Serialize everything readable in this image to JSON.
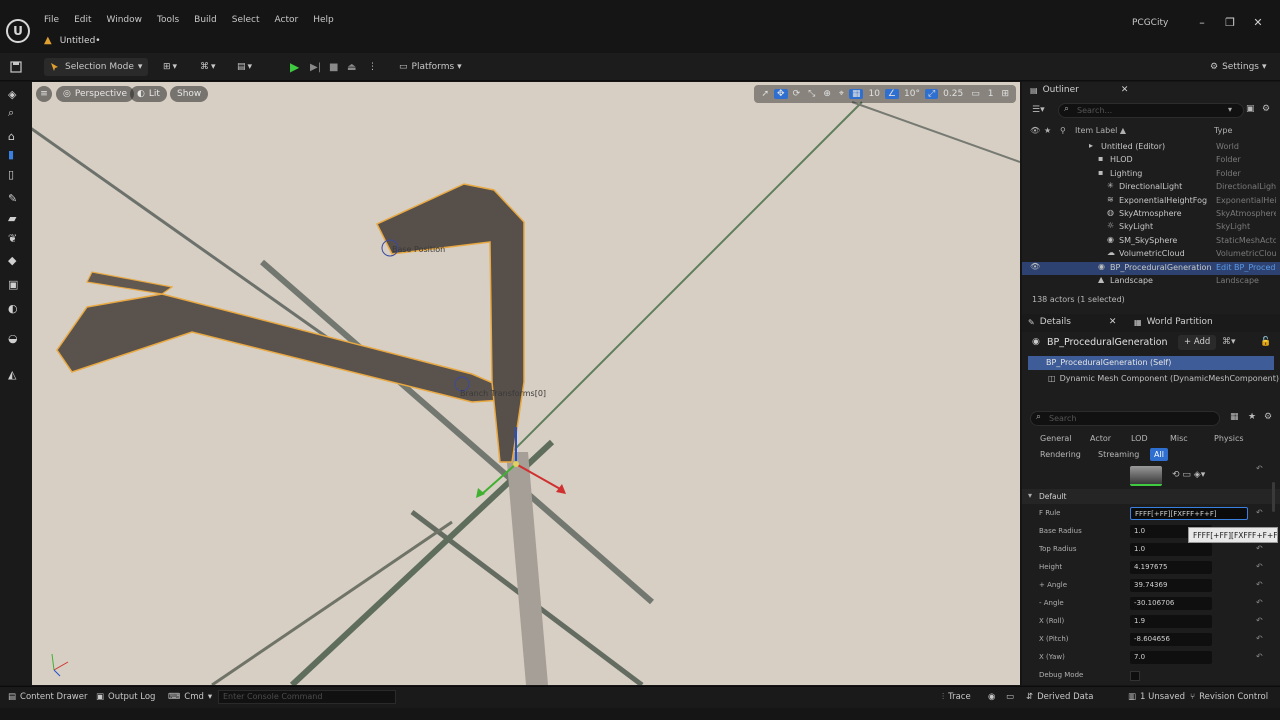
{
  "window": {
    "menu": [
      "File",
      "Edit",
      "Window",
      "Tools",
      "Build",
      "Select",
      "Actor",
      "Help"
    ],
    "document_tab": "Untitled•",
    "project_name": "PCGCity",
    "controls": [
      "–",
      "❐",
      "✕"
    ]
  },
  "toolbar": {
    "selection_mode": "Selection Mode",
    "platforms": "Platforms",
    "settings": "Settings"
  },
  "viewport": {
    "perspective": "Perspective",
    "lit": "Lit",
    "show": "Show",
    "grid_snap": "10",
    "rot_snap": "10°",
    "scale_snap": "0.25",
    "camera_speed": "1",
    "label_base_position": "Base Position",
    "label_branch": "Branch Transforms[0]"
  },
  "outliner": {
    "tab_label": "Outliner",
    "search_placeholder": "Search...",
    "col_item_label": "Item Label ▲",
    "col_type": "Type",
    "rows": [
      {
        "name": "Untitled (Editor)",
        "type": "World",
        "indent": 1,
        "icon": "▸"
      },
      {
        "name": "HLOD",
        "type": "Folder",
        "indent": 2,
        "icon": "▪"
      },
      {
        "name": "Lighting",
        "type": "Folder",
        "indent": 2,
        "icon": "▪"
      },
      {
        "name": "DirectionalLight",
        "type": "DirectionalLight",
        "indent": 3,
        "icon": "✳"
      },
      {
        "name": "ExponentialHeightFog",
        "type": "ExponentialHeightFog",
        "indent": 3,
        "icon": "≋"
      },
      {
        "name": "SkyAtmosphere",
        "type": "SkyAtmosphere",
        "indent": 3,
        "icon": "◍"
      },
      {
        "name": "SkyLight",
        "type": "SkyLight",
        "indent": 3,
        "icon": "☼"
      },
      {
        "name": "SM_SkySphere",
        "type": "StaticMeshActor",
        "indent": 3,
        "icon": "◉"
      },
      {
        "name": "VolumetricCloud",
        "type": "VolumetricCloud",
        "indent": 3,
        "icon": "☁"
      },
      {
        "name": "BP_ProceduralGeneration",
        "type": "Edit BP_ProceduralGeneration",
        "indent": 2,
        "icon": "◉",
        "selected": true
      },
      {
        "name": "Landscape",
        "type": "Landscape",
        "indent": 2,
        "icon": "▲"
      }
    ],
    "actor_count": "138 actors (1 selected)"
  },
  "details": {
    "tab_label": "Details",
    "world_partition_tab": "World Partition",
    "actor_name": "BP_ProceduralGeneration",
    "add_button": "+ Add",
    "component_self": "BP_ProceduralGeneration (Self)",
    "component_mesh": "Dynamic Mesh Component (DynamicMeshComponent)",
    "search_placeholder": "Search",
    "filters_row1": [
      "General",
      "Actor",
      "LOD",
      "Misc",
      "Physics"
    ],
    "filters_row2": [
      "Rendering",
      "Streaming",
      "All"
    ],
    "section_default": "Default",
    "props": [
      {
        "label": "F Rule",
        "value": "FFFF[+FF][FXFFF+F+F]"
      },
      {
        "label": "Base Radius",
        "value": "1.0"
      },
      {
        "label": "Top Radius",
        "value": "1.0"
      },
      {
        "label": "Height",
        "value": "4.197675"
      },
      {
        "label": "+ Angle",
        "value": "39.74369"
      },
      {
        "label": "- Angle",
        "value": "-30.106706"
      },
      {
        "label": "X (Roll)",
        "value": "1.9"
      },
      {
        "label": "X (Pitch)",
        "value": "-8.604656"
      },
      {
        "label": "X (Yaw)",
        "value": "7.0"
      },
      {
        "label": "Debug Mode",
        "value": ""
      }
    ],
    "tooltip": "FFFF[+FF][FXFFF+F+F]"
  },
  "bottombar": {
    "content_drawer": "Content Drawer",
    "output_log": "Output Log",
    "cmd": "Cmd",
    "console_placeholder": "Enter Console Command",
    "trace": "Trace",
    "derived_data": "Derived Data",
    "unsaved": "1 Unsaved",
    "revision_control": "Revision Control"
  }
}
